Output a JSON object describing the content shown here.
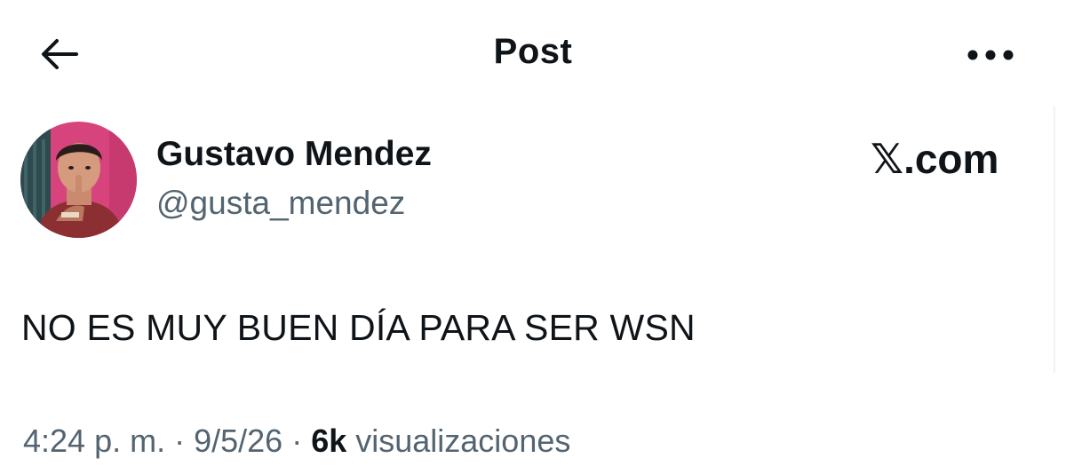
{
  "header": {
    "title": "Post",
    "back_icon": "arrow-left-icon",
    "more_icon": "more-horizontal-icon"
  },
  "author": {
    "display_name": "Gustavo Mendez",
    "handle": "@gusta_mendez",
    "avatar": "profile-photo"
  },
  "brand": {
    "glyph": "𝕏",
    "suffix": ".com"
  },
  "post": {
    "text": "NO ES MUY BUEN DÍA PARA SER WSN"
  },
  "meta": {
    "time": "4:24 p. m.",
    "sep1": " · ",
    "date": "9/5/26",
    "sep2": " · ",
    "views_count": "6k",
    "views_label": " visualizaciones"
  },
  "colors": {
    "text_primary": "#0f1419",
    "text_secondary": "#536471",
    "background": "#ffffff"
  }
}
